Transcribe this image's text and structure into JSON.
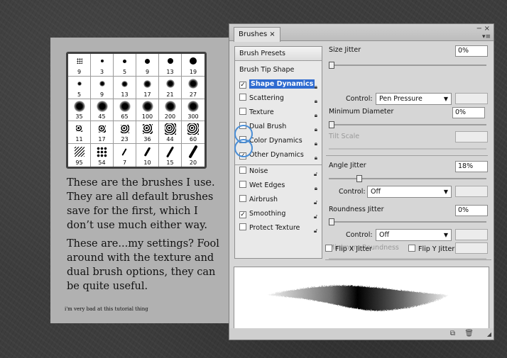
{
  "tutorial": {
    "brush_sizes": [
      [
        "9",
        "3",
        "5",
        "9",
        "13",
        "19"
      ],
      [
        "5",
        "9",
        "13",
        "17",
        "21",
        "27"
      ],
      [
        "35",
        "45",
        "65",
        "100",
        "200",
        "300"
      ],
      [
        "11",
        "17",
        "23",
        "36",
        "44",
        "60"
      ],
      [
        "95",
        "54",
        "7",
        "10",
        "15",
        "20"
      ]
    ],
    "paragraph1": "These are the brushes I use. They are all default brushes save for the first, which I don’t use much either way.",
    "paragraph2": "These are...my settings? Fool around with the texture and dual brush options, they can be quite useful.",
    "note": "i'm very bad at this tutorial thing"
  },
  "panel": {
    "tab_label": "Brushes",
    "tab_close": "×",
    "left": {
      "brush_presets": "Brush Presets",
      "brush_tip_shape": "Brush Tip Shape",
      "options": [
        {
          "label": "Shape Dynamics",
          "checked": true,
          "active": true,
          "locked": true
        },
        {
          "label": "Scattering",
          "checked": false,
          "active": false,
          "locked": true
        },
        {
          "label": "Texture",
          "checked": false,
          "active": false,
          "locked": true
        },
        {
          "label": "Dual Brush",
          "checked": false,
          "active": false,
          "locked": true
        },
        {
          "label": "Color Dynamics",
          "checked": false,
          "active": false,
          "locked": true
        },
        {
          "label": "Other Dynamics",
          "checked": true,
          "active": false,
          "locked": true
        }
      ],
      "options2": [
        {
          "label": "Noise",
          "checked": false
        },
        {
          "label": "Wet Edges",
          "checked": false
        },
        {
          "label": "Airbrush",
          "checked": false
        },
        {
          "label": "Smoothing",
          "checked": true
        },
        {
          "label": "Protect Texture",
          "checked": false
        }
      ]
    },
    "right": {
      "size_jitter_label": "Size Jitter",
      "size_jitter_value": "0%",
      "size_jitter_level": 0,
      "control_label": "Control:",
      "size_control": "Pen Pressure",
      "min_diameter_label": "Minimum Diameter",
      "min_diameter_value": "0%",
      "min_diameter_level": 0,
      "tilt_scale_label": "Tilt Scale",
      "angle_jitter_label": "Angle Jitter",
      "angle_jitter_value": "18%",
      "angle_jitter_level": 18,
      "angle_control": "Off",
      "roundness_jitter_label": "Roundness Jitter",
      "roundness_jitter_value": "0%",
      "roundness_jitter_level": 0,
      "roundness_control": "Off",
      "min_roundness_label": "Minimum Roundness",
      "flip_x": "Flip X Jitter",
      "flip_y": "Flip Y Jitter"
    }
  }
}
